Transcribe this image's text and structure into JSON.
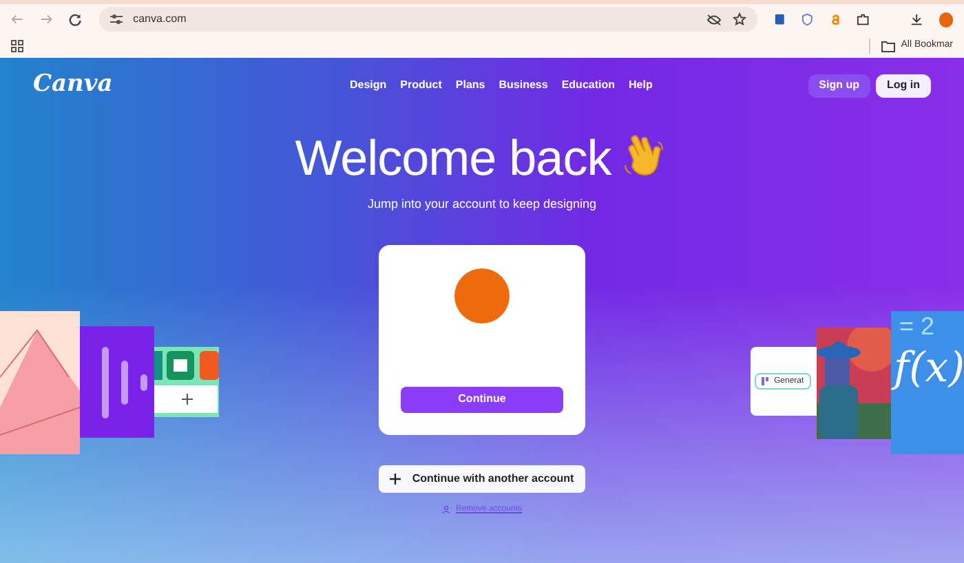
{
  "browser": {
    "url": "canva.com",
    "bookmarks": "All Bookmar"
  },
  "nav": {
    "brand": "Canva",
    "links": [
      "Design",
      "Product",
      "Plans",
      "Business",
      "Education",
      "Help"
    ],
    "sign_up": "Sign up",
    "log_in": "Log in"
  },
  "hero": {
    "title": "Welcome back",
    "subtitle": "Jump into your account to keep designing"
  },
  "card": {
    "continue": "Continue"
  },
  "other_account": "Continue with another account",
  "remove_accounts": "Remove accounts",
  "side_art": {
    "chip": "Generat",
    "math_top": "= 2",
    "math_main": "f(x)"
  }
}
